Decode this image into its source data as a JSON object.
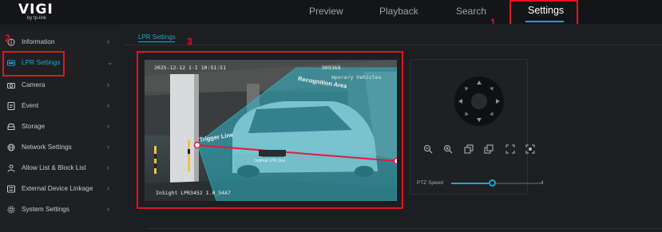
{
  "brand": {
    "name": "VIGI",
    "sub": "by tp-link"
  },
  "nav": {
    "tabs": [
      {
        "label": "Preview"
      },
      {
        "label": "Playback"
      },
      {
        "label": "Search"
      },
      {
        "label": "Settings"
      }
    ],
    "active": "Settings"
  },
  "annotations": {
    "n1": "1",
    "n2": "2",
    "n3": "3"
  },
  "sidebar": {
    "items": [
      {
        "label": "Information",
        "icon": "info-icon"
      },
      {
        "label": "LPR Settings",
        "icon": "lpr-icon",
        "active": true
      },
      {
        "label": "Camera",
        "icon": "camera-icon"
      },
      {
        "label": "Event",
        "icon": "event-icon"
      },
      {
        "label": "Storage",
        "icon": "storage-icon"
      },
      {
        "label": "Network Settings",
        "icon": "globe-icon"
      },
      {
        "label": "Allow List & Block List",
        "icon": "user-icon"
      },
      {
        "label": "External Device Linkage",
        "icon": "device-icon"
      },
      {
        "label": "System Settings",
        "icon": "gear-icon"
      }
    ]
  },
  "breadcrumb": "LPR Settings",
  "video": {
    "timestamp": "2025-12-12 1·I  10:51:51",
    "counter": "909368",
    "overlay_text": "mporary Vehicles",
    "recognition_area": "Recognition Area",
    "trigger_line": "Trigger Line",
    "optimal_lpr": "Optimal LPR Size",
    "camera_info": "InSight LPR3452 1.0_54A7"
  },
  "ptz": {
    "speed_label": "PTZ Speed",
    "speed_value": "4",
    "speed_fraction": 0.46,
    "tools": [
      "zoom-out-icon",
      "zoom-in-icon",
      "focus-near-icon",
      "focus-far-icon",
      "fullscreen-icon",
      "focus-target-icon"
    ]
  },
  "colors": {
    "accent": "#19a9cb",
    "highlight": "#e3141c",
    "background": "#1c1d21"
  }
}
